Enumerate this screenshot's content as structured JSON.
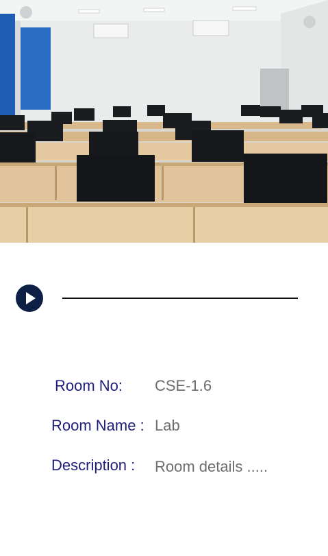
{
  "photo": {
    "subject": "computer-lab-photo"
  },
  "player": {
    "play_icon": "play-icon",
    "accent_color": "#0d1f44"
  },
  "room": {
    "number_label": "Room No:",
    "number_value": "CSE-1.6",
    "name_label": "Room Name :",
    "name_value": "Lab",
    "description_label": "Description :",
    "description_value": "Room details ....."
  },
  "colors": {
    "label": "#1f1f7a",
    "value": "#6d6d6d"
  }
}
